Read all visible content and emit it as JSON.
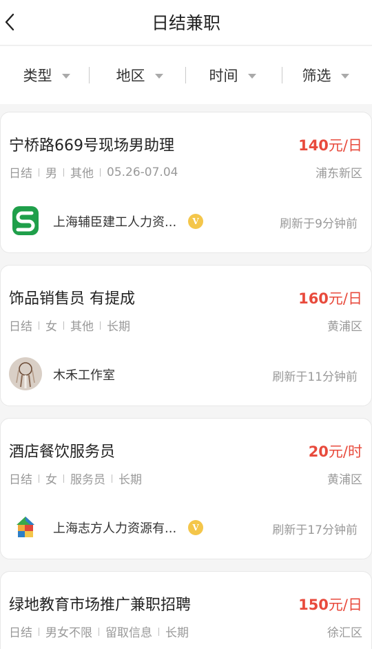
{
  "header": {
    "title": "日结兼职"
  },
  "filters": [
    {
      "label": "类型"
    },
    {
      "label": "地区"
    },
    {
      "label": "时间"
    },
    {
      "label": "筛选"
    }
  ],
  "colors": {
    "salary": "#e84a3c",
    "badge": "#f4c64a"
  },
  "jobs": [
    {
      "title": "宁桥路669号现场男助理",
      "salary_num": "140",
      "salary_unit": "元/日",
      "tags": [
        "日结",
        "男",
        "其他",
        "05.26-07.04"
      ],
      "district": "浦东新区",
      "company": "上海辅臣建工人力资...",
      "verified": true,
      "logo": "green-s-logo",
      "refresh": "刷新于9分钟前"
    },
    {
      "title": "饰品销售员 有提成",
      "salary_num": "160",
      "salary_unit": "元/日",
      "tags": [
        "日结",
        "女",
        "其他",
        "长期"
      ],
      "district": "黄浦区",
      "company": "木禾工作室",
      "verified": false,
      "logo": "dreamcatcher-avatar",
      "refresh": "刷新于11分钟前"
    },
    {
      "title": "酒店餐饮服务员",
      "salary_num": "20",
      "salary_unit": "元/时",
      "tags": [
        "日结",
        "女",
        "服务员",
        "长期"
      ],
      "district": "黄浦区",
      "company": "上海志方人力资源有...",
      "verified": true,
      "logo": "colorful-house-logo",
      "refresh": "刷新于17分钟前"
    },
    {
      "title": "绿地教育市场推广兼职招聘",
      "salary_num": "150",
      "salary_unit": "元/日",
      "tags": [
        "日结",
        "男女不限",
        "留取信息",
        "长期"
      ],
      "district": "徐汇区"
    }
  ],
  "verified_badge_text": "V"
}
